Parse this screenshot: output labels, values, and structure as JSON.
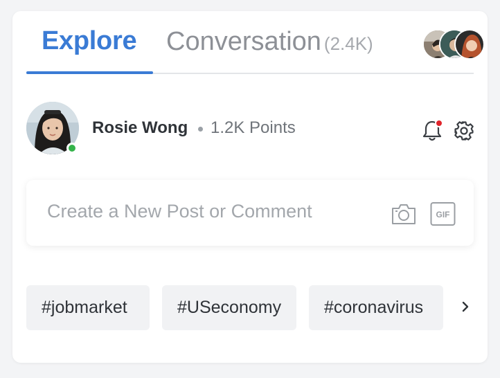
{
  "tabs": [
    {
      "label": "Explore",
      "active": true
    },
    {
      "label": "Conversation",
      "count": "(2.4K)",
      "active": false
    }
  ],
  "participants": [
    {
      "icon": "participant-avatar-1"
    },
    {
      "icon": "participant-avatar-2"
    },
    {
      "icon": "participant-avatar-3"
    }
  ],
  "user": {
    "name": "Rosie Wong",
    "points": "1.2K Points",
    "status": "online"
  },
  "header_actions": {
    "notifications_icon": "bell-icon",
    "settings_icon": "gear-icon",
    "has_unread": true
  },
  "composer": {
    "placeholder": "Create a New Post or Comment",
    "camera_icon": "camera-icon",
    "gif_label": "GIF"
  },
  "hashtags": [
    "#jobmarket",
    "#USeconomy",
    "#coronavirus"
  ],
  "colors": {
    "accent": "#3a7bd5",
    "online": "#34b34a",
    "notification": "#e0242b"
  }
}
